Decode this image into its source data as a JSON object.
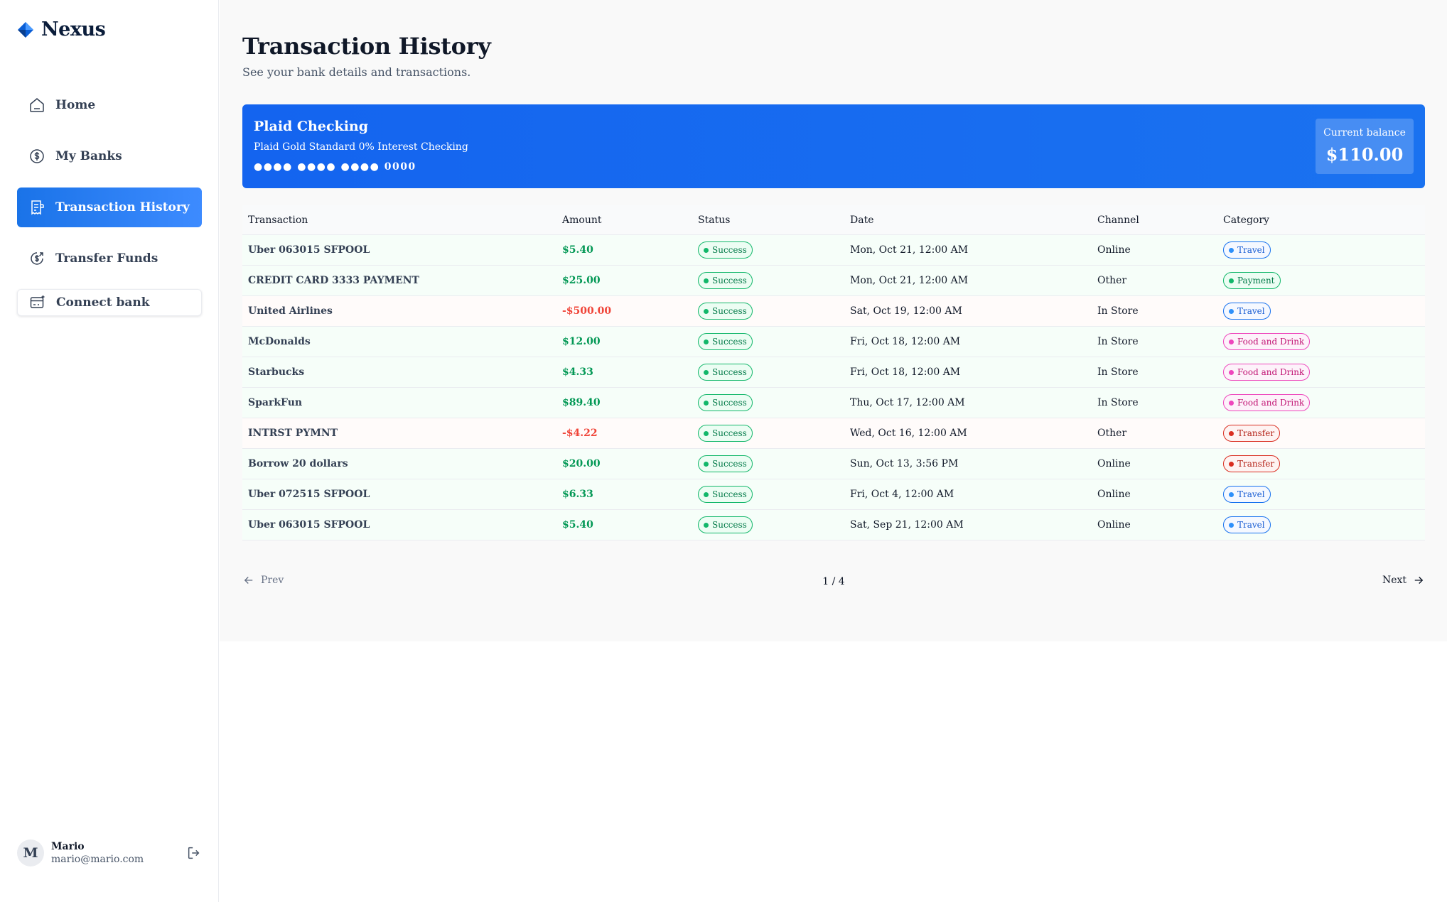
{
  "app": {
    "name": "Nexus"
  },
  "sidebar": {
    "items": [
      {
        "label": "Home",
        "icon": "home-icon"
      },
      {
        "label": "My Banks",
        "icon": "dollar-icon"
      },
      {
        "label": "Transaction History",
        "icon": "receipt-icon",
        "active": true
      },
      {
        "label": "Transfer Funds",
        "icon": "money-send-icon"
      }
    ],
    "connect_label": "Connect bank"
  },
  "user": {
    "initial": "M",
    "name": "Mario",
    "email": "mario@mario.com"
  },
  "header": {
    "title": "Transaction History",
    "subtitle": "See your bank details and transactions."
  },
  "bank": {
    "name": "Plaid Checking",
    "official_name": "Plaid Gold Standard 0% Interest Checking",
    "mask": "●●●● ●●●● ●●●● 0000",
    "balance_label": "Current balance",
    "balance": "$110.00"
  },
  "table": {
    "columns": [
      "Transaction",
      "Amount",
      "Status",
      "Date",
      "Channel",
      "Category"
    ],
    "rows": [
      {
        "name": "Uber 063015 SFPOOL",
        "amount": "$5.40",
        "status": "Success",
        "date": "Mon, Oct 21, 12:00 AM",
        "channel": "Online",
        "category": "Travel"
      },
      {
        "name": "CREDIT CARD 3333 PAYMENT",
        "amount": "$25.00",
        "status": "Success",
        "date": "Mon, Oct 21, 12:00 AM",
        "channel": "Other",
        "category": "Payment"
      },
      {
        "name": "United Airlines",
        "amount": "-$500.00",
        "status": "Success",
        "date": "Sat, Oct 19, 12:00 AM",
        "channel": "In Store",
        "category": "Travel"
      },
      {
        "name": "McDonalds",
        "amount": "$12.00",
        "status": "Success",
        "date": "Fri, Oct 18, 12:00 AM",
        "channel": "In Store",
        "category": "Food and Drink"
      },
      {
        "name": "Starbucks",
        "amount": "$4.33",
        "status": "Success",
        "date": "Fri, Oct 18, 12:00 AM",
        "channel": "In Store",
        "category": "Food and Drink"
      },
      {
        "name": "SparkFun",
        "amount": "$89.40",
        "status": "Success",
        "date": "Thu, Oct 17, 12:00 AM",
        "channel": "In Store",
        "category": "Food and Drink"
      },
      {
        "name": "INTRST PYMNT",
        "amount": "-$4.22",
        "status": "Success",
        "date": "Wed, Oct 16, 12:00 AM",
        "channel": "Other",
        "category": "Transfer"
      },
      {
        "name": "Borrow 20 dollars",
        "amount": "$20.00",
        "status": "Success",
        "date": "Sun, Oct 13, 3:56 PM",
        "channel": "Online",
        "category": "Transfer"
      },
      {
        "name": "Uber 072515 SFPOOL",
        "amount": "$6.33",
        "status": "Success",
        "date": "Fri, Oct 4, 12:00 AM",
        "channel": "Online",
        "category": "Travel"
      },
      {
        "name": "Uber 063015 SFPOOL",
        "amount": "$5.40",
        "status": "Success",
        "date": "Sat, Sep 21, 12:00 AM",
        "channel": "Online",
        "category": "Travel"
      }
    ]
  },
  "pagination": {
    "prev_label": "Prev",
    "page": "1 / 4",
    "next_label": "Next"
  },
  "colors": {
    "accent": "#1570ef",
    "positive": "#039855",
    "negative": "#f04438"
  }
}
